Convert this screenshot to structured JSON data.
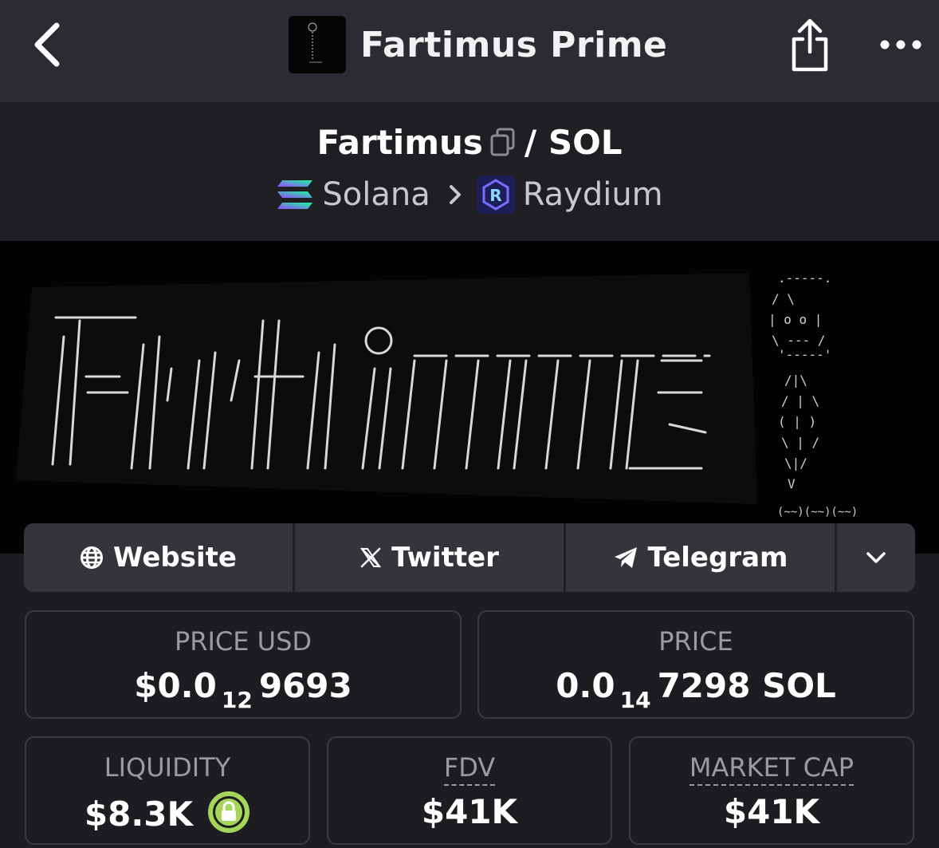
{
  "header": {
    "app_title": "Fartimus Prime",
    "icons": {
      "back": "chevron-left-icon",
      "share": "share-icon",
      "more": "more-horizontal-icon"
    }
  },
  "pair": {
    "base": "Fartimus",
    "separator": "/ SOL",
    "chain": "Solana",
    "dex": "Raydium"
  },
  "banner": {
    "logo_text": "Fartimus",
    "figure_text": "(~~)(~~)(~~)"
  },
  "links": {
    "website": "Website",
    "twitter": "Twitter",
    "telegram": "Telegram",
    "icons": [
      "globe-icon",
      "x-logo-icon",
      "telegram-icon",
      "chevron-down-icon"
    ]
  },
  "stats": {
    "price_usd_label": "PRICE USD",
    "price_usd_prefix": "$0.0",
    "price_usd_zeros": "12",
    "price_usd_digits": "9693",
    "price_label": "PRICE",
    "price_prefix": "0.0",
    "price_zeros": "14",
    "price_digits": "7298 SOL",
    "liquidity_label": "LIQUIDITY",
    "liquidity_value": "$8.3K",
    "fdv_label": "FDV",
    "fdv_value": "$41K",
    "mcap_label": "MARKET CAP",
    "mcap_value": "$41K"
  },
  "colors": {
    "background": "#1c1c21",
    "topbar": "#2b2b31",
    "link_bar": "#34343b",
    "lock_green": "#a5d65a"
  }
}
